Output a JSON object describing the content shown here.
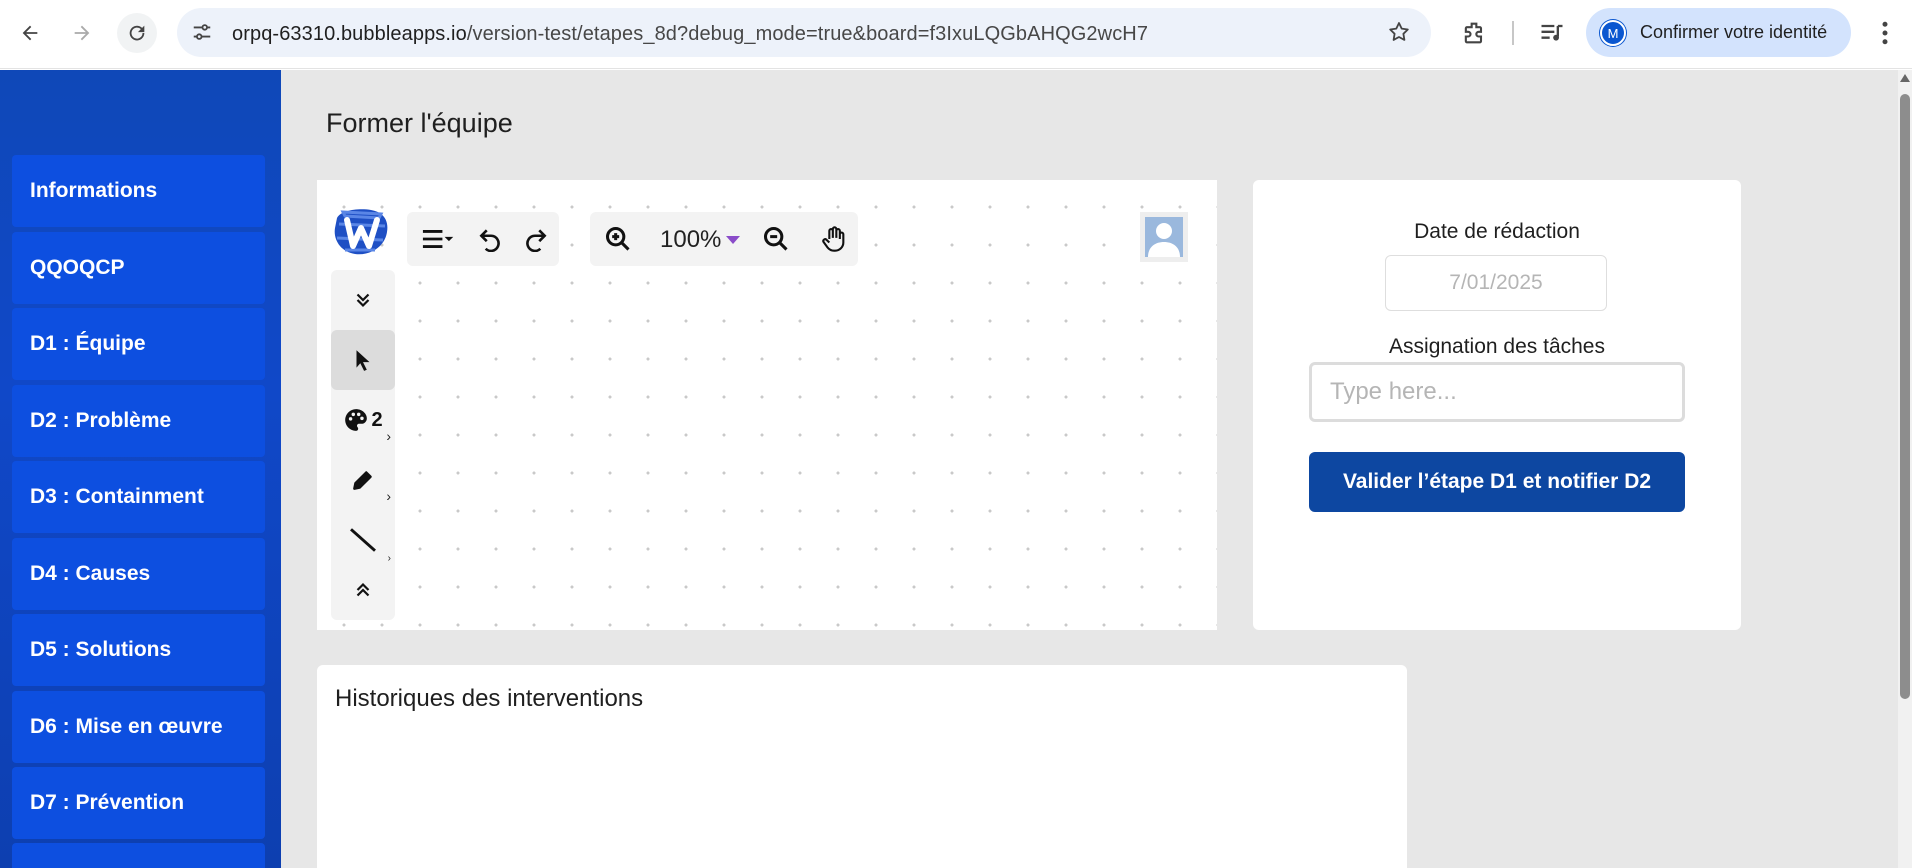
{
  "browser": {
    "url_host": "orpq-63310.bubbleapps.io",
    "url_path": "/version-test/etapes_8d?debug_mode=true&board=f3IxuLQGbAHQG2wcH7",
    "profile_initial": "M",
    "profile_label": "Confirmer votre identité"
  },
  "sidebar": {
    "items": [
      {
        "label": "Informations"
      },
      {
        "label": "QQOQCP"
      },
      {
        "label": "D1 : Équipe"
      },
      {
        "label": "D2 : Problème"
      },
      {
        "label": "D3 : Containment"
      },
      {
        "label": "D4 : Causes"
      },
      {
        "label": "D5 : Solutions"
      },
      {
        "label": "D6 : Mise en œuvre"
      },
      {
        "label": "D7 : Prévention"
      },
      {
        "label": ""
      }
    ]
  },
  "main": {
    "title": "Former l'équipe"
  },
  "whiteboard": {
    "zoom": "100%",
    "color_count": "2",
    "colors": {
      "logo": "#1e4fc4",
      "accent": "#8a4cc9"
    }
  },
  "form": {
    "date_label": "Date de rédaction",
    "date_value": "7/01/2025",
    "assign_label": "Assignation des tâches",
    "assign_placeholder": "Type here...",
    "validate_label": "Valider l’étape D1 et notifier D2"
  },
  "history": {
    "title": "Historiques des interventions"
  },
  "colors": {
    "sidebar_bg": "#1048c8",
    "sidebar_item": "#0d4fe0",
    "primary_button": "#0d47a1",
    "page_bg": "#e7e7e7"
  }
}
